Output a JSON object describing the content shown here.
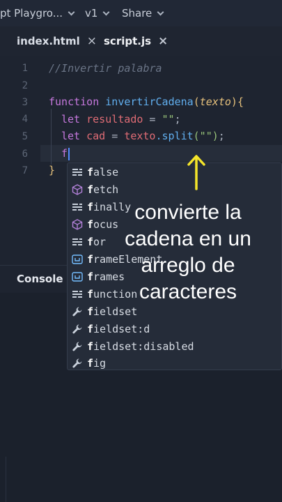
{
  "topbar": {
    "title": "pt Playgro...",
    "version": "v1",
    "share": "Share"
  },
  "tabs": [
    {
      "label": "index.html",
      "close": "×"
    },
    {
      "label": "script.js",
      "close": "×"
    }
  ],
  "editor": {
    "line_numbers": [
      "1",
      "2",
      "3",
      "4",
      "5",
      "6",
      "7"
    ],
    "comment": "//Invertir palabra",
    "kw_function": "function",
    "fn_name": "invertirCadena",
    "paren_open": "(",
    "param": "texto",
    "paren_close": ")",
    "brace_open": "{",
    "kw_let": "let",
    "var_resultado": "resultado",
    "assign": " = ",
    "str_empty": "\"\"",
    "semicolon": ";",
    "var_cad": "cad",
    "texto": "texto",
    "dot_split": ".split",
    "split_args": "(\"\")",
    "typed": "f",
    "brace_close": "}"
  },
  "autocomplete": {
    "items": [
      {
        "label": "false",
        "icon": "keyword-icon"
      },
      {
        "label": "fetch",
        "icon": "method-icon"
      },
      {
        "label": "finally",
        "icon": "keyword-icon"
      },
      {
        "label": "focus",
        "icon": "method-icon"
      },
      {
        "label": "for",
        "icon": "keyword-icon"
      },
      {
        "label": "frameElement",
        "icon": "variable-icon"
      },
      {
        "label": "frames",
        "icon": "variable-icon"
      },
      {
        "label": "function",
        "icon": "keyword-icon"
      },
      {
        "label": "fieldset",
        "icon": "wrench-icon"
      },
      {
        "label": "fieldset:d",
        "icon": "wrench-icon"
      },
      {
        "label": "fieldset:disabled",
        "icon": "wrench-icon"
      },
      {
        "label": "fig",
        "icon": "wrench-icon"
      }
    ]
  },
  "console": {
    "title": "Console"
  },
  "annotation": {
    "caption": "convierte la cadena en un arreglo de caracteres",
    "arrow_color": "#f5e52a"
  }
}
